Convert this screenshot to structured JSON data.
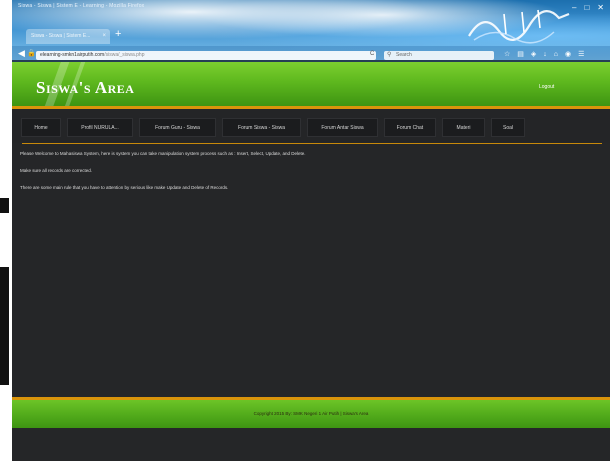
{
  "browser": {
    "window_title": "Siswa - Siswa | Sistem E - Learning - Mozilla Firefox",
    "tab_label": "Siswa - Siswa | Sistem E...",
    "tab_close": "×",
    "new_tab": "+",
    "url_domain": "elearning-smkn1airputih.com",
    "url_path": "/siswa/_siswa.php",
    "search_placeholder": "Search",
    "reload": "C",
    "arabic_logo_text": "بسم الله الرحمن الرحيم"
  },
  "header": {
    "site_title": "Siswa's Area",
    "logout": "Logout"
  },
  "menu": {
    "items": [
      {
        "label": "Home"
      },
      {
        "label": "Profil NURULA..."
      },
      {
        "label": "Forum Guru - Siswa"
      },
      {
        "label": "Forum Siswa - Siswa"
      },
      {
        "label": "Forum Antar Siswa"
      },
      {
        "label": "Forum Chat"
      },
      {
        "label": "Materi"
      },
      {
        "label": "Soal"
      }
    ]
  },
  "content": {
    "line1": "Please Welcome to Mahasiswa System, here is system you can take manipulation system process such as : Insert, Select, Update, and Delete.",
    "line2": "Make sure all records are corrected.",
    "line3": "There are some main rule that you have to attention by serious like make Update and Delete of Records."
  },
  "footer": {
    "copyright": "Copyright 2015 By: SMK Negeri 1 Air Putih | Siswa's Area"
  },
  "colors": {
    "header_green": "#5eb81e",
    "accent_orange": "#d9940b",
    "page_background": "#252628",
    "menu_item_background": "#1b1c1e"
  }
}
